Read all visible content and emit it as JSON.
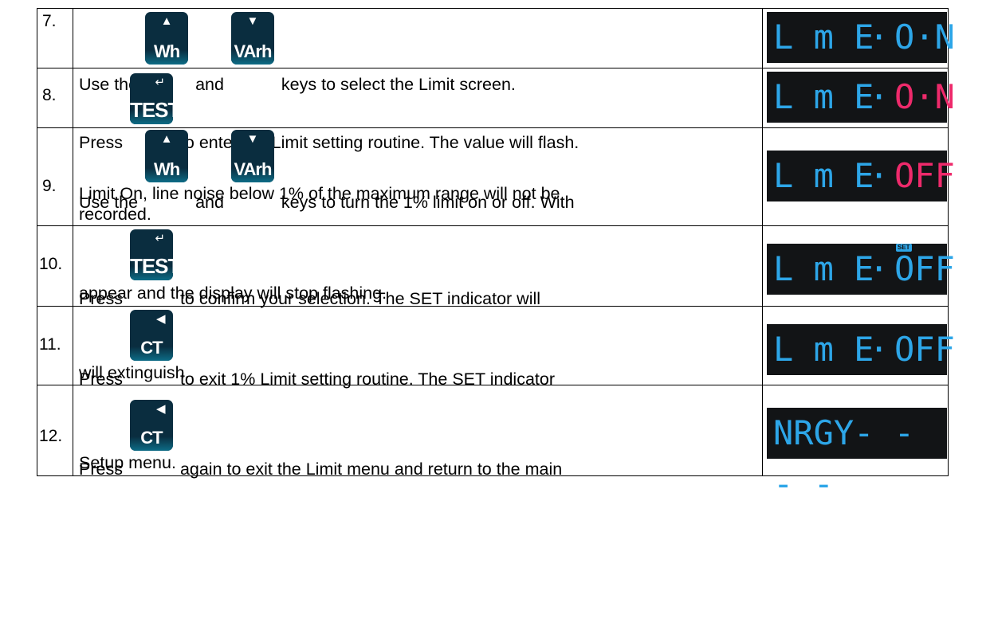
{
  "keys": {
    "wh": "Wh",
    "varh": "VArh",
    "test": "TEST",
    "ct": "CT"
  },
  "glyphs": {
    "up": "▲",
    "down": "▼",
    "enter": "↵",
    "left": "◀"
  },
  "rows": [
    {
      "num": "7.",
      "pre": "Use the",
      "mid": "and",
      "post": "keys to select the Limit screen.",
      "display": {
        "label": "L m E",
        "dot": "·",
        "value": "O·N",
        "value_color": "#2da6e8"
      }
    },
    {
      "num": "8.",
      "pre": "Press",
      "post": "to enter the Limit setting routine.  The value will flash.",
      "display": {
        "label": "L m E",
        "dot": "·",
        "value": "O·N",
        "value_color": "#ee2a6b"
      }
    },
    {
      "num": "9.",
      "pre": "Use the",
      "mid": "and",
      "post": "keys to turn the 1% limit on or off.  With",
      "line2": "Limit On, line noise below 1% of the maximum range will not be",
      "line3": "recorded.",
      "display": {
        "label": "L m E",
        "dot": "·",
        "value": "OFF",
        "value_color": "#ee2a6b"
      }
    },
    {
      "num": "10.",
      "pre": "Press",
      "post": "to confirm your selection.  The SET indicator will",
      "line2": "appear and the display will stop flashing.",
      "display": {
        "label": "L m E",
        "dot": "·",
        "value": "OFF",
        "value_color": "#2da6e8",
        "badge": "SET"
      }
    },
    {
      "num": "11.",
      "pre": "Press",
      "post": "to exit 1% Limit setting routine.  The SET indicator",
      "line2": "will extinguish.",
      "display": {
        "label": "L m E",
        "dot": "·",
        "value": "OFF",
        "value_color": "#2da6e8"
      }
    },
    {
      "num": "12.",
      "pre": "Press",
      "post": "again to exit the Limit menu and return to the main",
      "line2": "Setup menu.",
      "display": {
        "label": "NRGY- - - -",
        "value_color": "#2da6e8"
      }
    }
  ]
}
